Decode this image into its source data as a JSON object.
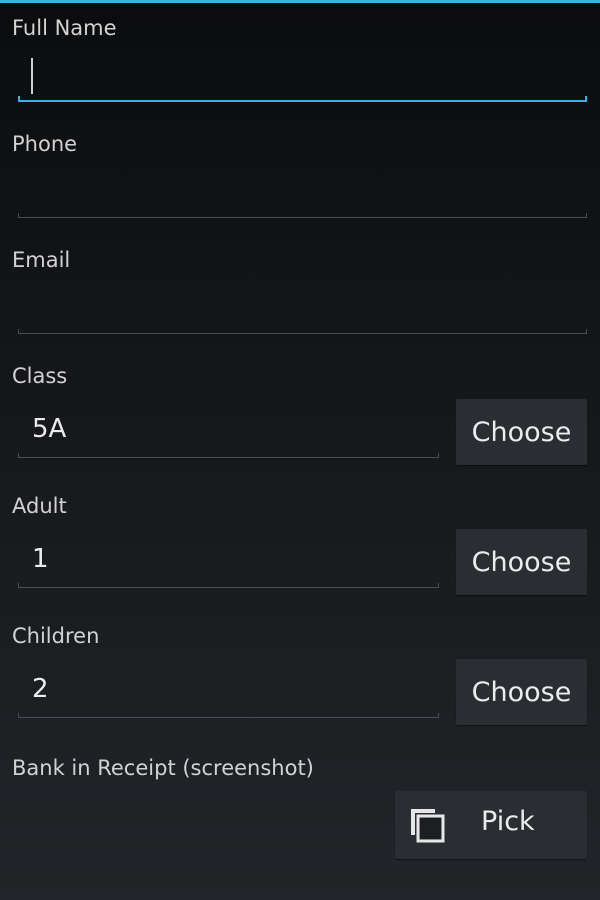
{
  "form": {
    "full_name": {
      "label": "Full Name",
      "value": ""
    },
    "phone": {
      "label": "Phone",
      "value": ""
    },
    "email": {
      "label": "Email",
      "value": ""
    },
    "class": {
      "label": "Class",
      "value": "5A",
      "button": "Choose"
    },
    "adult": {
      "label": "Adult",
      "value": "1",
      "button": "Choose"
    },
    "children": {
      "label": "Children",
      "value": "2",
      "button": "Choose"
    },
    "receipt": {
      "label": "Bank in Receipt (screenshot)",
      "button": "Pick",
      "icon": "image-stack-icon"
    }
  },
  "colors": {
    "accent": "#33b5e5",
    "background": "#101214",
    "button": "#2a2d31"
  }
}
